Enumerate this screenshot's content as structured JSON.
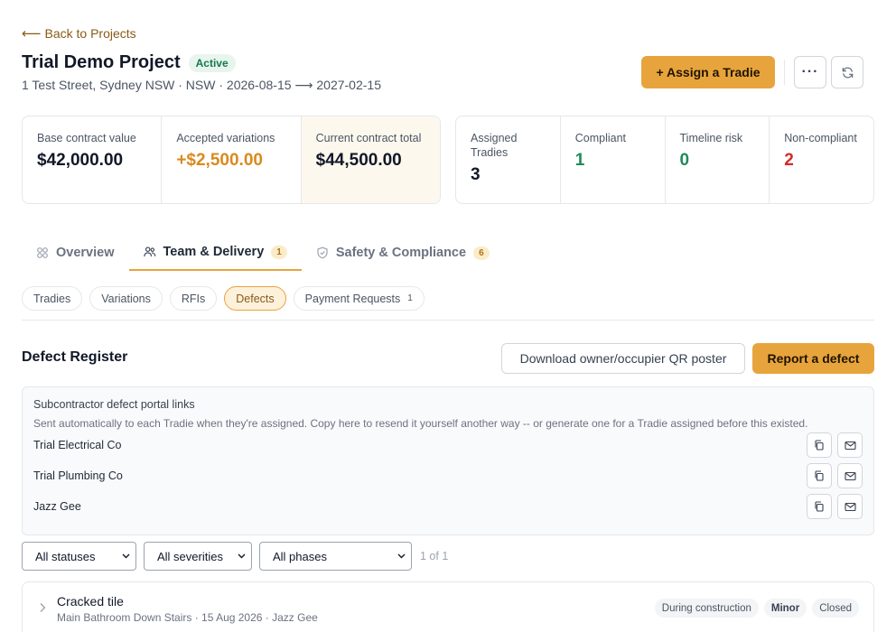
{
  "nav": {
    "back_label": "Back to Projects",
    "back_arrow": "⟵"
  },
  "project": {
    "title": "Trial Demo Project",
    "status": "Active",
    "subtitle": "1 Test Street, Sydney NSW · NSW · 2026-08-15 ⟶ 2027-02-15"
  },
  "header_actions": {
    "assign_label": "+ Assign a Tradie",
    "more_label": "···"
  },
  "stats_left": [
    {
      "label": "Base contract value",
      "value": "$42,000.00",
      "tone": "dark"
    },
    {
      "label": "Accepted variations",
      "value": "+$2,500.00",
      "tone": "orange"
    },
    {
      "label": "Current contract total",
      "value": "$44,500.00",
      "tone": "dark"
    }
  ],
  "stats_right": [
    {
      "label": "Assigned Tradies",
      "value": "3",
      "tone": "dark"
    },
    {
      "label": "Compliant",
      "value": "1",
      "tone": "green"
    },
    {
      "label": "Timeline risk",
      "value": "0",
      "tone": "green"
    },
    {
      "label": "Non-compliant",
      "value": "2",
      "tone": "red"
    }
  ],
  "tabs": [
    {
      "label": "Overview",
      "icon": "overview-icon"
    },
    {
      "label": "Team & Delivery",
      "icon": "team-icon",
      "badge": "1"
    },
    {
      "label": "Safety & Compliance",
      "icon": "shield-icon",
      "badge": "6"
    }
  ],
  "subtabs": [
    {
      "label": "Tradies"
    },
    {
      "label": "Variations"
    },
    {
      "label": "RFIs"
    },
    {
      "label": "Defects"
    },
    {
      "label": "Payment Requests",
      "count": "1"
    }
  ],
  "defects": {
    "title": "Defect Register",
    "qr_button": "Download owner/occupier QR poster",
    "report_button": "Report a defect"
  },
  "portal": {
    "title": "Subcontractor defect portal links",
    "description": "Sent automatically to each Tradie when they're assigned. Copy here to resend it yourself another way -- or generate one for a Tradie assigned before this existed.",
    "tradies": [
      {
        "name": "Trial Electrical Co"
      },
      {
        "name": "Trial Plumbing Co"
      },
      {
        "name": "Jazz Gee"
      }
    ]
  },
  "filters": {
    "status": "All statuses",
    "severity": "All severities",
    "phase": "All phases",
    "pager": "1 of 1"
  },
  "defect_items": [
    {
      "title": "Cracked tile",
      "meta": "Main Bathroom Down Stairs · 15 Aug 2026 · Jazz Gee",
      "tags": [
        "During construction",
        "Minor",
        "Closed"
      ]
    }
  ],
  "colors": {
    "accent": "#e8a43c",
    "link": "#8a5a16",
    "success": "#1f8a5c",
    "danger": "#d42a2a",
    "orange": "#d98a1e"
  }
}
